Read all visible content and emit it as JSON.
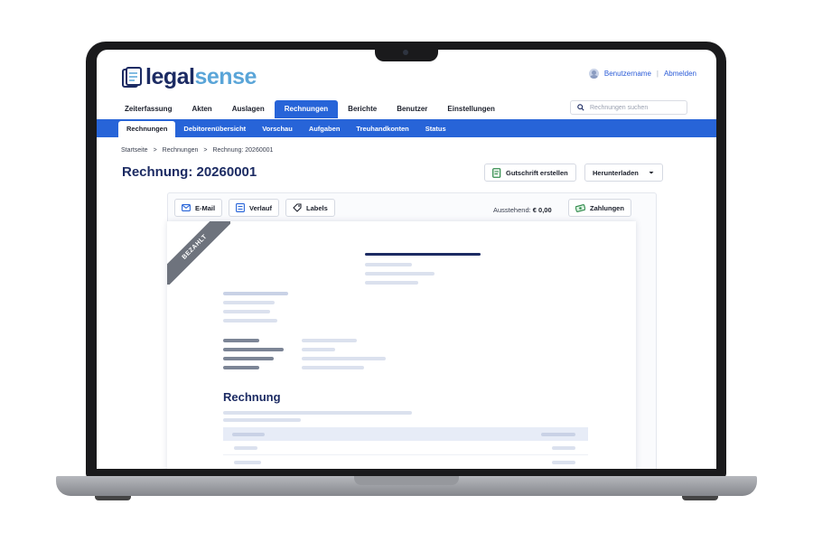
{
  "app": {
    "logo_main": "legal",
    "logo_accent": "sense"
  },
  "header": {
    "username": "Benutzername",
    "separator": "|",
    "logout": "Abmelden"
  },
  "main_nav": [
    {
      "label": "Zeiterfassung"
    },
    {
      "label": "Akten"
    },
    {
      "label": "Auslagen"
    },
    {
      "label": "Rechnungen",
      "active": true
    },
    {
      "label": "Berichte"
    },
    {
      "label": "Benutzer"
    },
    {
      "label": "Einstellungen"
    }
  ],
  "search": {
    "placeholder": "Rechnungen suchen"
  },
  "sub_nav": [
    {
      "label": "Rechnungen",
      "active": true
    },
    {
      "label": "Debitorenübersicht"
    },
    {
      "label": "Vorschau"
    },
    {
      "label": "Aufgaben"
    },
    {
      "label": "Treuhandkonten"
    },
    {
      "label": "Status"
    }
  ],
  "breadcrumb": {
    "items": [
      "Startseite",
      "Rechnungen",
      "Rechnung: 20260001"
    ],
    "separator": ">"
  },
  "page": {
    "title": "Rechnung: 20260001",
    "credit_button": "Gutschrift erstellen",
    "download_button": "Herunterladen"
  },
  "toolbar": {
    "email": "E-Mail",
    "history": "Verlauf",
    "labels": "Labels",
    "outstanding_label": "Ausstehend:",
    "outstanding_value": "€ 0,00",
    "payments": "Zahlungen"
  },
  "document": {
    "stamp": "BEZAHLT",
    "heading": "Rechnung"
  },
  "colors": {
    "brand_dark": "#1c2b63",
    "brand_light": "#5aa5d8",
    "primary": "#2764d8",
    "stamp": "#6e737d"
  }
}
